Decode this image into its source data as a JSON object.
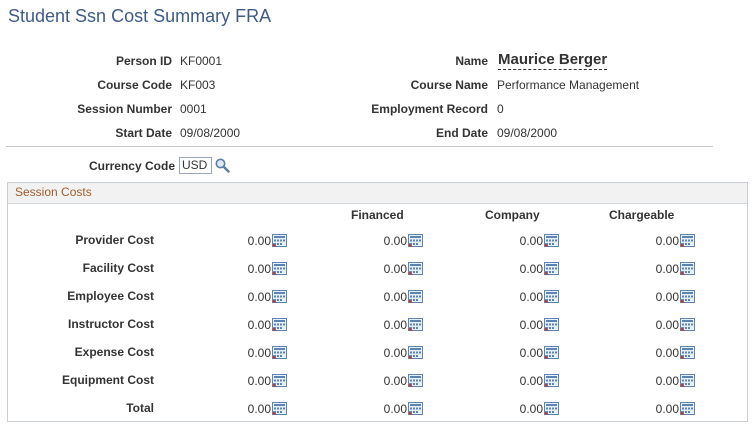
{
  "page": {
    "title": "Student Ssn Cost Summary FRA"
  },
  "header": {
    "person_id": {
      "label": "Person ID",
      "value": "KF0001"
    },
    "name": {
      "label": "Name",
      "value": "Maurice Berger"
    },
    "course_code": {
      "label": "Course Code",
      "value": "KF003"
    },
    "course_name": {
      "label": "Course Name",
      "value": "Performance Management"
    },
    "session_number": {
      "label": "Session Number",
      "value": "0001"
    },
    "employment_record": {
      "label": "Employment Record",
      "value": "0"
    },
    "start_date": {
      "label": "Start Date",
      "value": "09/08/2000"
    },
    "end_date": {
      "label": "End Date",
      "value": "09/08/2000"
    }
  },
  "currency": {
    "label": "Currency Code",
    "value": "USD"
  },
  "session_costs": {
    "title": "Session Costs",
    "columns": [
      "Financed",
      "Company",
      "Chargeable"
    ],
    "rows": [
      {
        "label": "Provider Cost",
        "values": [
          "0.00",
          "0.00",
          "0.00",
          "0.00"
        ]
      },
      {
        "label": "Facility Cost",
        "values": [
          "0.00",
          "0.00",
          "0.00",
          "0.00"
        ]
      },
      {
        "label": "Employee Cost",
        "values": [
          "0.00",
          "0.00",
          "0.00",
          "0.00"
        ]
      },
      {
        "label": "Instructor Cost",
        "values": [
          "0.00",
          "0.00",
          "0.00",
          "0.00"
        ]
      },
      {
        "label": "Expense Cost",
        "values": [
          "0.00",
          "0.00",
          "0.00",
          "0.00"
        ]
      },
      {
        "label": "Equipment Cost",
        "values": [
          "0.00",
          "0.00",
          "0.00",
          "0.00"
        ]
      },
      {
        "label": "Total",
        "values": [
          "0.00",
          "0.00",
          "0.00",
          "0.00"
        ]
      }
    ]
  }
}
